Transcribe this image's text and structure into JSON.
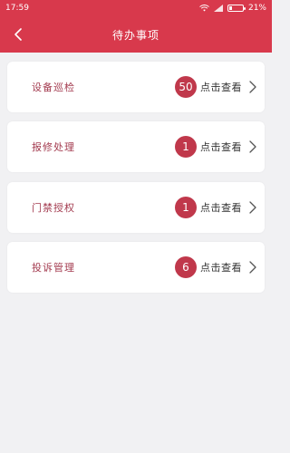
{
  "status_bar": {
    "time": "17:59",
    "battery_percent": "21%"
  },
  "header": {
    "title": "待办事项"
  },
  "items": [
    {
      "label": "设备巡检",
      "count": "50",
      "action": "点击查看"
    },
    {
      "label": "报修处理",
      "count": "1",
      "action": "点击查看"
    },
    {
      "label": "门禁授权",
      "count": "1",
      "action": "点击查看"
    },
    {
      "label": "投诉管理",
      "count": "6",
      "action": "点击查看"
    }
  ],
  "theme": {
    "primary": "#d8394c",
    "badge": "#c0384b",
    "label": "#a33b4f",
    "background": "#f1f1f3"
  },
  "icons": [
    "wifi-icon",
    "signal-icon",
    "battery-icon",
    "back-icon",
    "chevron-right-icon"
  ]
}
